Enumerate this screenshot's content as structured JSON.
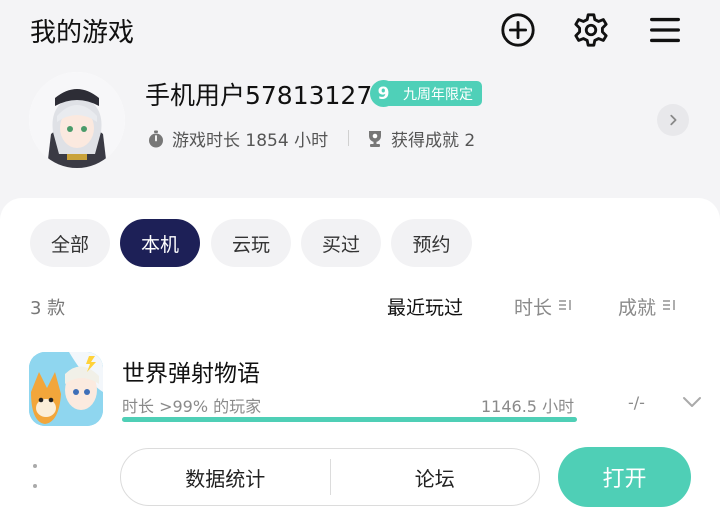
{
  "header": {
    "title": "我的游戏",
    "icons": [
      "add-circle-icon",
      "gear-icon",
      "menu-icon"
    ]
  },
  "profile": {
    "username": "手机用户57813127",
    "badge_number": "9",
    "badge_label": "九周年限定",
    "playtime_label": "游戏时长 1854 小时",
    "achievements_label": "获得成就 2"
  },
  "tabs": [
    {
      "label": "全部",
      "active": false
    },
    {
      "label": "本机",
      "active": true
    },
    {
      "label": "云玩",
      "active": false
    },
    {
      "label": "买过",
      "active": false
    },
    {
      "label": "预约",
      "active": false
    }
  ],
  "list": {
    "count": "3 款",
    "sort": {
      "recent": "最近玩过",
      "duration": "时长",
      "achievements": "成就"
    }
  },
  "game": {
    "title": "世界弹射物语",
    "playtime_rank": "时长 >99% 的玩家",
    "playtime_value": "1146.5 小时",
    "playtime_progress": 1.0,
    "achievements": "-/-",
    "actions": {
      "stats": "数据统计",
      "forum": "论坛",
      "open": "打开"
    }
  },
  "colors": {
    "accent": "#4fcfb6",
    "active_tab": "#1d2057",
    "background": "#f4f4f6"
  }
}
